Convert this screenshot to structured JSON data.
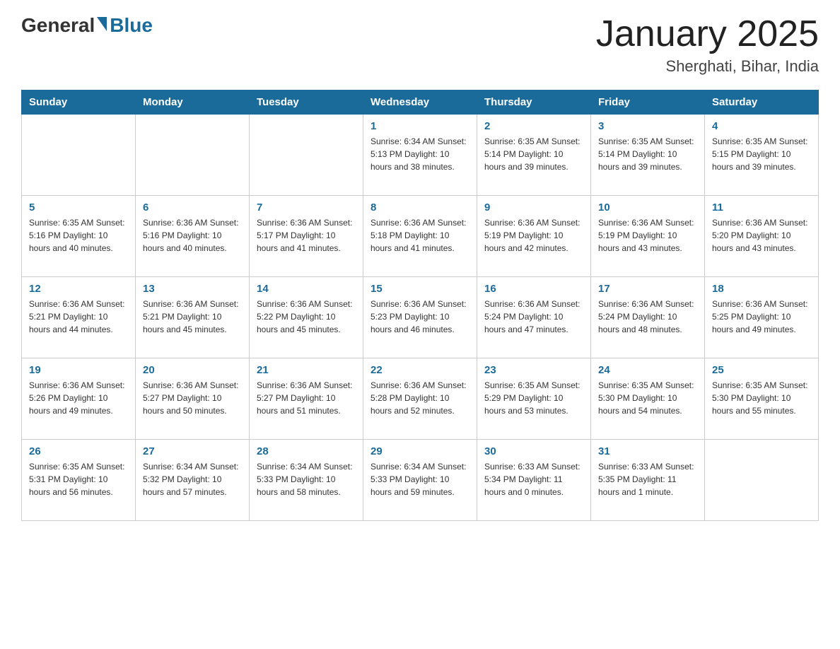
{
  "header": {
    "logo_general": "General",
    "logo_blue": "Blue",
    "month": "January 2025",
    "location": "Sherghati, Bihar, India"
  },
  "days_of_week": [
    "Sunday",
    "Monday",
    "Tuesday",
    "Wednesday",
    "Thursday",
    "Friday",
    "Saturday"
  ],
  "weeks": [
    {
      "days": [
        {
          "number": "",
          "info": ""
        },
        {
          "number": "",
          "info": ""
        },
        {
          "number": "",
          "info": ""
        },
        {
          "number": "1",
          "info": "Sunrise: 6:34 AM\nSunset: 5:13 PM\nDaylight: 10 hours\nand 38 minutes."
        },
        {
          "number": "2",
          "info": "Sunrise: 6:35 AM\nSunset: 5:14 PM\nDaylight: 10 hours\nand 39 minutes."
        },
        {
          "number": "3",
          "info": "Sunrise: 6:35 AM\nSunset: 5:14 PM\nDaylight: 10 hours\nand 39 minutes."
        },
        {
          "number": "4",
          "info": "Sunrise: 6:35 AM\nSunset: 5:15 PM\nDaylight: 10 hours\nand 39 minutes."
        }
      ]
    },
    {
      "days": [
        {
          "number": "5",
          "info": "Sunrise: 6:35 AM\nSunset: 5:16 PM\nDaylight: 10 hours\nand 40 minutes."
        },
        {
          "number": "6",
          "info": "Sunrise: 6:36 AM\nSunset: 5:16 PM\nDaylight: 10 hours\nand 40 minutes."
        },
        {
          "number": "7",
          "info": "Sunrise: 6:36 AM\nSunset: 5:17 PM\nDaylight: 10 hours\nand 41 minutes."
        },
        {
          "number": "8",
          "info": "Sunrise: 6:36 AM\nSunset: 5:18 PM\nDaylight: 10 hours\nand 41 minutes."
        },
        {
          "number": "9",
          "info": "Sunrise: 6:36 AM\nSunset: 5:19 PM\nDaylight: 10 hours\nand 42 minutes."
        },
        {
          "number": "10",
          "info": "Sunrise: 6:36 AM\nSunset: 5:19 PM\nDaylight: 10 hours\nand 43 minutes."
        },
        {
          "number": "11",
          "info": "Sunrise: 6:36 AM\nSunset: 5:20 PM\nDaylight: 10 hours\nand 43 minutes."
        }
      ]
    },
    {
      "days": [
        {
          "number": "12",
          "info": "Sunrise: 6:36 AM\nSunset: 5:21 PM\nDaylight: 10 hours\nand 44 minutes."
        },
        {
          "number": "13",
          "info": "Sunrise: 6:36 AM\nSunset: 5:21 PM\nDaylight: 10 hours\nand 45 minutes."
        },
        {
          "number": "14",
          "info": "Sunrise: 6:36 AM\nSunset: 5:22 PM\nDaylight: 10 hours\nand 45 minutes."
        },
        {
          "number": "15",
          "info": "Sunrise: 6:36 AM\nSunset: 5:23 PM\nDaylight: 10 hours\nand 46 minutes."
        },
        {
          "number": "16",
          "info": "Sunrise: 6:36 AM\nSunset: 5:24 PM\nDaylight: 10 hours\nand 47 minutes."
        },
        {
          "number": "17",
          "info": "Sunrise: 6:36 AM\nSunset: 5:24 PM\nDaylight: 10 hours\nand 48 minutes."
        },
        {
          "number": "18",
          "info": "Sunrise: 6:36 AM\nSunset: 5:25 PM\nDaylight: 10 hours\nand 49 minutes."
        }
      ]
    },
    {
      "days": [
        {
          "number": "19",
          "info": "Sunrise: 6:36 AM\nSunset: 5:26 PM\nDaylight: 10 hours\nand 49 minutes."
        },
        {
          "number": "20",
          "info": "Sunrise: 6:36 AM\nSunset: 5:27 PM\nDaylight: 10 hours\nand 50 minutes."
        },
        {
          "number": "21",
          "info": "Sunrise: 6:36 AM\nSunset: 5:27 PM\nDaylight: 10 hours\nand 51 minutes."
        },
        {
          "number": "22",
          "info": "Sunrise: 6:36 AM\nSunset: 5:28 PM\nDaylight: 10 hours\nand 52 minutes."
        },
        {
          "number": "23",
          "info": "Sunrise: 6:35 AM\nSunset: 5:29 PM\nDaylight: 10 hours\nand 53 minutes."
        },
        {
          "number": "24",
          "info": "Sunrise: 6:35 AM\nSunset: 5:30 PM\nDaylight: 10 hours\nand 54 minutes."
        },
        {
          "number": "25",
          "info": "Sunrise: 6:35 AM\nSunset: 5:30 PM\nDaylight: 10 hours\nand 55 minutes."
        }
      ]
    },
    {
      "days": [
        {
          "number": "26",
          "info": "Sunrise: 6:35 AM\nSunset: 5:31 PM\nDaylight: 10 hours\nand 56 minutes."
        },
        {
          "number": "27",
          "info": "Sunrise: 6:34 AM\nSunset: 5:32 PM\nDaylight: 10 hours\nand 57 minutes."
        },
        {
          "number": "28",
          "info": "Sunrise: 6:34 AM\nSunset: 5:33 PM\nDaylight: 10 hours\nand 58 minutes."
        },
        {
          "number": "29",
          "info": "Sunrise: 6:34 AM\nSunset: 5:33 PM\nDaylight: 10 hours\nand 59 minutes."
        },
        {
          "number": "30",
          "info": "Sunrise: 6:33 AM\nSunset: 5:34 PM\nDaylight: 11 hours\nand 0 minutes."
        },
        {
          "number": "31",
          "info": "Sunrise: 6:33 AM\nSunset: 5:35 PM\nDaylight: 11 hours\nand 1 minute."
        },
        {
          "number": "",
          "info": ""
        }
      ]
    }
  ]
}
